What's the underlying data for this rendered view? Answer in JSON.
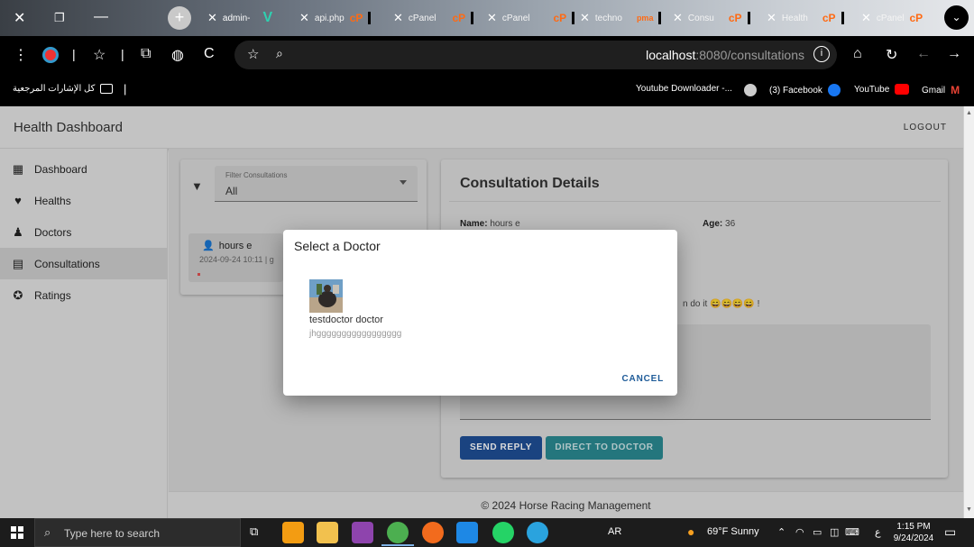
{
  "browser": {
    "tabs": [
      {
        "label": "admin-"
      },
      {
        "label": "api.php"
      },
      {
        "label": "cPanel"
      },
      {
        "label": "cPanel"
      },
      {
        "label": "techno"
      },
      {
        "label": "Consu"
      },
      {
        "label": "Health"
      },
      {
        "label": "cPanel"
      }
    ],
    "url_host": "localhost",
    "url_path": ":8080/consultations",
    "bookmarks": {
      "all_bookmarks": "كل الإشارات المرجعية",
      "youtube_downloader": "Youtube Downloader -...",
      "facebook": "(3) Facebook",
      "youtube": "YouTube",
      "gmail": "Gmail"
    }
  },
  "app": {
    "title": "Health Dashboard",
    "logout": "LOGOUT",
    "sidebar": [
      {
        "label": "Dashboard",
        "icon": "dashboard-icon"
      },
      {
        "label": "Healths",
        "icon": "heartbeat-icon"
      },
      {
        "label": "Doctors",
        "icon": "doctor-icon"
      },
      {
        "label": "Consultations",
        "icon": "chat-icon"
      },
      {
        "label": "Ratings",
        "icon": "star-icon"
      }
    ],
    "filter": {
      "label": "Filter Consultations",
      "value": "All"
    },
    "consultation_item": {
      "name": "hours e",
      "date": "2024-09-24 10:11 | g"
    },
    "details": {
      "heading": "Consultation Details",
      "name_label": "Name:",
      "name_value": "hours e",
      "age_label": "Age:",
      "age_value": "36",
      "message_tail": "n do it 😄😄😄😄 !",
      "send_reply": "SEND REPLY",
      "direct_to_doctor": "DIRECT TO DOCTOR"
    },
    "footer": "© 2024 Horse Racing Management"
  },
  "dialog": {
    "title": "Select a Doctor",
    "doctor_name": "testdoctor doctor",
    "doctor_sub": "jhggggggggggggggggg",
    "cancel": "CANCEL"
  },
  "taskbar": {
    "search_placeholder": "Type here to search",
    "lang": "AR",
    "weather": "69°F  Sunny",
    "time": "1:15 PM",
    "date": "9/24/2024"
  },
  "colors": {
    "send_reply": "#1f4f95",
    "direct_to_doctor": "#2a8a92",
    "cancel_text": "#1f5c99"
  }
}
